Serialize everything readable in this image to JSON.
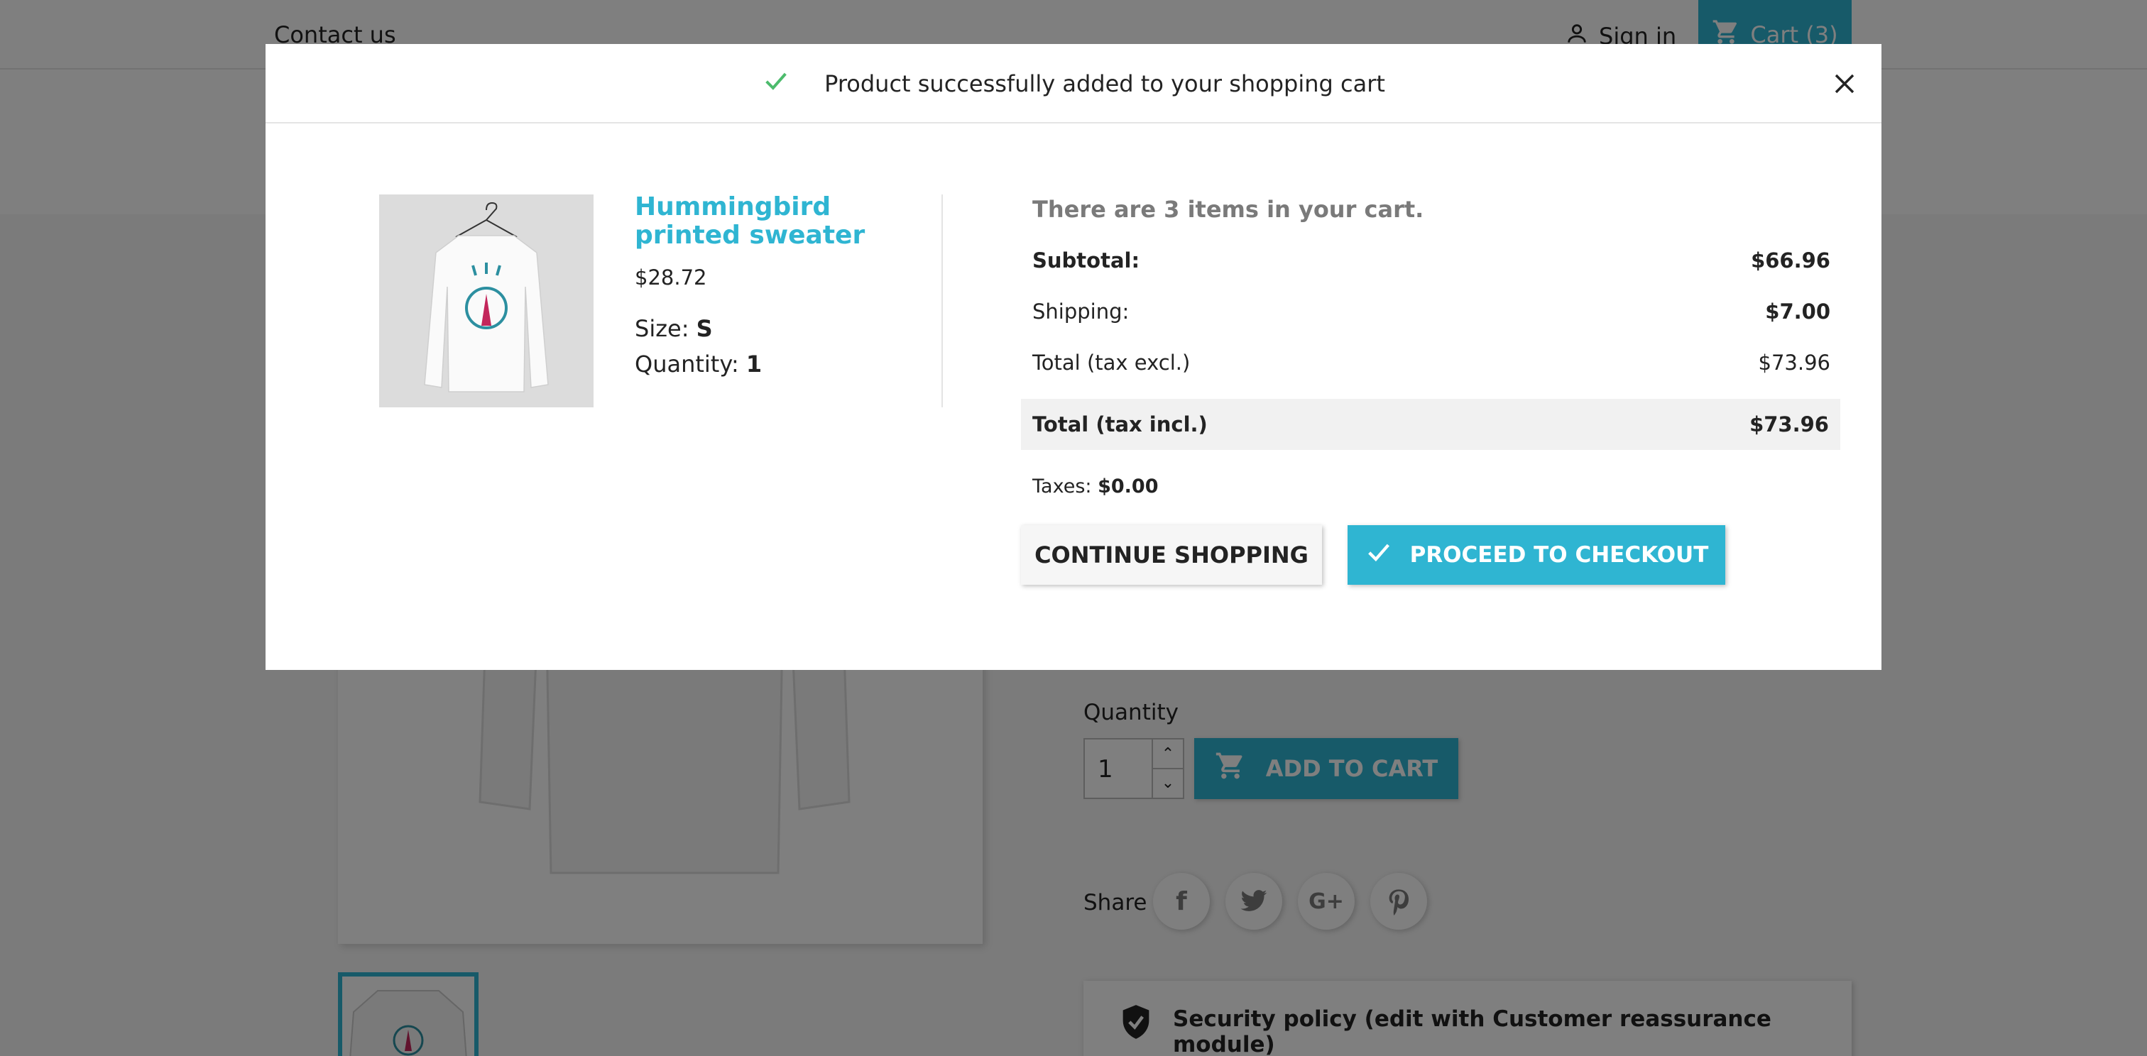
{
  "header": {
    "contact_label": "Contact us",
    "signin_label": "Sign in",
    "cart_label": "Cart (3)"
  },
  "product_page": {
    "quantity_label": "Quantity",
    "quantity_value": "1",
    "add_to_cart_label": "ADD TO CART",
    "share_label": "Share",
    "share_networks": [
      "facebook",
      "twitter",
      "google-plus",
      "pinterest"
    ],
    "reassurance_text": "Security policy (edit with Customer reassurance module)"
  },
  "modal": {
    "title": "Product successfully added to your shopping cart",
    "product": {
      "name": "Hummingbird printed sweater",
      "price": "$28.72",
      "size_label": "Size:",
      "size_value": "S",
      "quantity_label": "Quantity:",
      "quantity_value": "1"
    },
    "cart": {
      "count_text": "There are 3 items in your cart.",
      "subtotal_label": "Subtotal:",
      "subtotal_value": "$66.96",
      "shipping_label": "Shipping:",
      "shipping_value": "$7.00",
      "total_excl_label": "Total (tax excl.)",
      "total_excl_value": "$73.96",
      "total_incl_label": "Total (tax incl.)",
      "total_incl_value": "$73.96",
      "taxes_label": "Taxes:",
      "taxes_value": "$0.00"
    },
    "continue_label": "CONTINUE SHOPPING",
    "checkout_label": "PROCEED TO CHECKOUT"
  },
  "colors": {
    "accent": "#2fb5d2",
    "success_check": "#4cbb6c",
    "text": "#232323",
    "muted": "#7a7a7a"
  }
}
